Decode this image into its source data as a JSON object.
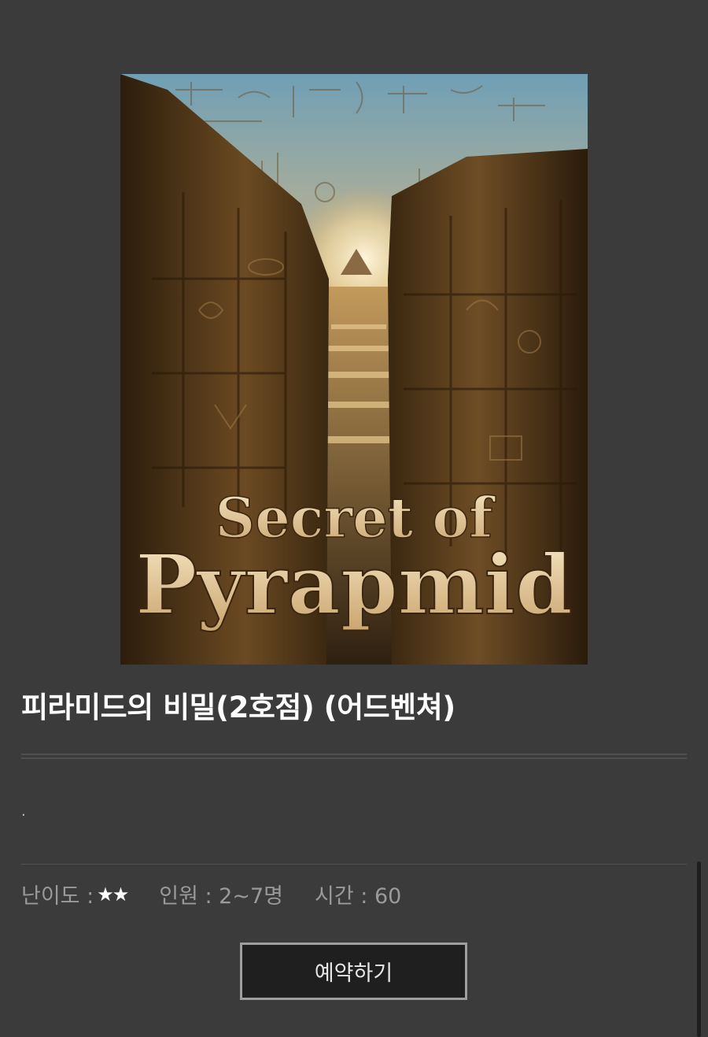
{
  "product": {
    "title": "피라미드의 비밀(2호점) (어드벤쳐)",
    "description": ".",
    "poster": {
      "line1": "Secret of",
      "line2": "Pyrapmid"
    }
  },
  "info": {
    "difficulty_label": "난이도 :",
    "difficulty_stars": "★★",
    "difficulty_level": 2,
    "players": "인원 : 2~7명",
    "time": "시간 : 60"
  },
  "actions": {
    "reserve_label": "예약하기"
  },
  "colors": {
    "background": "#3b3b3b",
    "button_bg": "#1f1f1f",
    "button_border": "#9e9e9e",
    "title": "#ffffff",
    "info_text": "#9a9a9a"
  }
}
